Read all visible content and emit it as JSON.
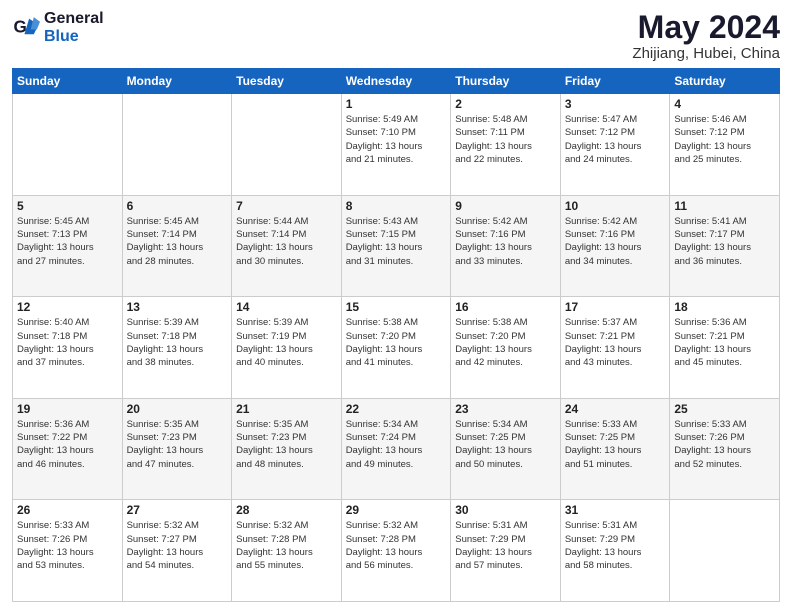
{
  "logo": {
    "line1": "General",
    "line2": "Blue"
  },
  "title": "May 2024",
  "subtitle": "Zhijiang, Hubei, China",
  "header_days": [
    "Sunday",
    "Monday",
    "Tuesday",
    "Wednesday",
    "Thursday",
    "Friday",
    "Saturday"
  ],
  "weeks": [
    [
      {
        "day": "",
        "info": ""
      },
      {
        "day": "",
        "info": ""
      },
      {
        "day": "",
        "info": ""
      },
      {
        "day": "1",
        "info": "Sunrise: 5:49 AM\nSunset: 7:10 PM\nDaylight: 13 hours\nand 21 minutes."
      },
      {
        "day": "2",
        "info": "Sunrise: 5:48 AM\nSunset: 7:11 PM\nDaylight: 13 hours\nand 22 minutes."
      },
      {
        "day": "3",
        "info": "Sunrise: 5:47 AM\nSunset: 7:12 PM\nDaylight: 13 hours\nand 24 minutes."
      },
      {
        "day": "4",
        "info": "Sunrise: 5:46 AM\nSunset: 7:12 PM\nDaylight: 13 hours\nand 25 minutes."
      }
    ],
    [
      {
        "day": "5",
        "info": "Sunrise: 5:45 AM\nSunset: 7:13 PM\nDaylight: 13 hours\nand 27 minutes."
      },
      {
        "day": "6",
        "info": "Sunrise: 5:45 AM\nSunset: 7:14 PM\nDaylight: 13 hours\nand 28 minutes."
      },
      {
        "day": "7",
        "info": "Sunrise: 5:44 AM\nSunset: 7:14 PM\nDaylight: 13 hours\nand 30 minutes."
      },
      {
        "day": "8",
        "info": "Sunrise: 5:43 AM\nSunset: 7:15 PM\nDaylight: 13 hours\nand 31 minutes."
      },
      {
        "day": "9",
        "info": "Sunrise: 5:42 AM\nSunset: 7:16 PM\nDaylight: 13 hours\nand 33 minutes."
      },
      {
        "day": "10",
        "info": "Sunrise: 5:42 AM\nSunset: 7:16 PM\nDaylight: 13 hours\nand 34 minutes."
      },
      {
        "day": "11",
        "info": "Sunrise: 5:41 AM\nSunset: 7:17 PM\nDaylight: 13 hours\nand 36 minutes."
      }
    ],
    [
      {
        "day": "12",
        "info": "Sunrise: 5:40 AM\nSunset: 7:18 PM\nDaylight: 13 hours\nand 37 minutes."
      },
      {
        "day": "13",
        "info": "Sunrise: 5:39 AM\nSunset: 7:18 PM\nDaylight: 13 hours\nand 38 minutes."
      },
      {
        "day": "14",
        "info": "Sunrise: 5:39 AM\nSunset: 7:19 PM\nDaylight: 13 hours\nand 40 minutes."
      },
      {
        "day": "15",
        "info": "Sunrise: 5:38 AM\nSunset: 7:20 PM\nDaylight: 13 hours\nand 41 minutes."
      },
      {
        "day": "16",
        "info": "Sunrise: 5:38 AM\nSunset: 7:20 PM\nDaylight: 13 hours\nand 42 minutes."
      },
      {
        "day": "17",
        "info": "Sunrise: 5:37 AM\nSunset: 7:21 PM\nDaylight: 13 hours\nand 43 minutes."
      },
      {
        "day": "18",
        "info": "Sunrise: 5:36 AM\nSunset: 7:21 PM\nDaylight: 13 hours\nand 45 minutes."
      }
    ],
    [
      {
        "day": "19",
        "info": "Sunrise: 5:36 AM\nSunset: 7:22 PM\nDaylight: 13 hours\nand 46 minutes."
      },
      {
        "day": "20",
        "info": "Sunrise: 5:35 AM\nSunset: 7:23 PM\nDaylight: 13 hours\nand 47 minutes."
      },
      {
        "day": "21",
        "info": "Sunrise: 5:35 AM\nSunset: 7:23 PM\nDaylight: 13 hours\nand 48 minutes."
      },
      {
        "day": "22",
        "info": "Sunrise: 5:34 AM\nSunset: 7:24 PM\nDaylight: 13 hours\nand 49 minutes."
      },
      {
        "day": "23",
        "info": "Sunrise: 5:34 AM\nSunset: 7:25 PM\nDaylight: 13 hours\nand 50 minutes."
      },
      {
        "day": "24",
        "info": "Sunrise: 5:33 AM\nSunset: 7:25 PM\nDaylight: 13 hours\nand 51 minutes."
      },
      {
        "day": "25",
        "info": "Sunrise: 5:33 AM\nSunset: 7:26 PM\nDaylight: 13 hours\nand 52 minutes."
      }
    ],
    [
      {
        "day": "26",
        "info": "Sunrise: 5:33 AM\nSunset: 7:26 PM\nDaylight: 13 hours\nand 53 minutes."
      },
      {
        "day": "27",
        "info": "Sunrise: 5:32 AM\nSunset: 7:27 PM\nDaylight: 13 hours\nand 54 minutes."
      },
      {
        "day": "28",
        "info": "Sunrise: 5:32 AM\nSunset: 7:28 PM\nDaylight: 13 hours\nand 55 minutes."
      },
      {
        "day": "29",
        "info": "Sunrise: 5:32 AM\nSunset: 7:28 PM\nDaylight: 13 hours\nand 56 minutes."
      },
      {
        "day": "30",
        "info": "Sunrise: 5:31 AM\nSunset: 7:29 PM\nDaylight: 13 hours\nand 57 minutes."
      },
      {
        "day": "31",
        "info": "Sunrise: 5:31 AM\nSunset: 7:29 PM\nDaylight: 13 hours\nand 58 minutes."
      },
      {
        "day": "",
        "info": ""
      }
    ]
  ]
}
